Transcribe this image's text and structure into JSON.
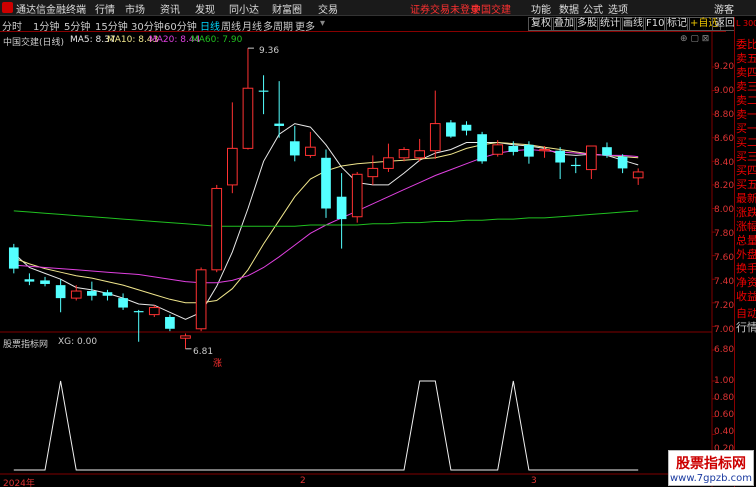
{
  "menubar": {
    "app_title": "通达信金融终端",
    "menus": [
      "行情",
      "市场",
      "资讯",
      "发现",
      "同小达",
      "财富圈",
      "交易"
    ],
    "notice": "证券交易未登录",
    "stock_name_right": "中国交建",
    "right_menus": [
      "功能",
      "数据",
      "公式",
      "选项"
    ],
    "guest": "游客"
  },
  "toolbar": {
    "periods": [
      "分时",
      "1分钟",
      "5分钟",
      "15分钟",
      "30分钟",
      "60分钟",
      "日线",
      "周线",
      "月线",
      "多周期",
      "更多"
    ],
    "active_period": "日线",
    "right_buttons": [
      "复权",
      "叠加",
      "多股",
      "统计",
      "画线",
      "F10",
      "标记",
      "+自选",
      "返回"
    ]
  },
  "right_panel": {
    "top_label": "L 300",
    "items": [
      "委比",
      "卖五",
      "卖四",
      "卖三",
      "卖二",
      "卖一",
      "买一",
      "买二",
      "买三",
      "买四",
      "买五",
      "最新",
      "涨跌",
      "涨幅",
      "总量",
      "外盘",
      "换手",
      "净资",
      "收益",
      "自动",
      "行情"
    ]
  },
  "main_chart": {
    "title": "中国交建(日线)",
    "ma_labels": [
      {
        "text": "MA5: 8.37",
        "color": "#e8e8e8"
      },
      {
        "text": "MA10: 8.43",
        "color": "#f0e68c"
      },
      {
        "text": "MA20: 8.44",
        "color": "#e040e0"
      },
      {
        "text": "MA60: 7.90",
        "color": "#20c020"
      }
    ],
    "high_label": "9.36",
    "low_label": "6.81",
    "zhang_label": "涨",
    "ylabels": [
      "9.20",
      "9.00",
      "8.80",
      "8.60",
      "8.40",
      "8.20",
      "8.00",
      "7.80",
      "7.60",
      "7.40",
      "7.20",
      "7.00",
      "6.80"
    ]
  },
  "sub_chart": {
    "title": "股票指标网",
    "xg_label": "XG: 0.00",
    "ylabels": [
      "1.00",
      "0.80",
      "0.60",
      "0.40",
      "0.20"
    ]
  },
  "x_axis": {
    "labels": [
      "2024年",
      "2",
      "3"
    ]
  },
  "watermark": {
    "line1": "股票指标网",
    "line2": "www.7gpzb.com"
  },
  "chart_data": {
    "type": "candlestick",
    "title": "中国交建(日线)",
    "ylim": [
      6.7,
      9.4
    ],
    "candles": [
      {
        "o": 7.67,
        "c": 7.49,
        "h": 7.7,
        "l": 7.45
      },
      {
        "o": 7.4,
        "c": 7.38,
        "h": 7.45,
        "l": 7.35
      },
      {
        "o": 7.39,
        "c": 7.36,
        "h": 7.42,
        "l": 7.34
      },
      {
        "o": 7.35,
        "c": 7.24,
        "h": 7.4,
        "l": 7.12
      },
      {
        "o": 7.24,
        "c": 7.3,
        "h": 7.35,
        "l": 7.22
      },
      {
        "o": 7.3,
        "c": 7.26,
        "h": 7.38,
        "l": 7.22
      },
      {
        "o": 7.29,
        "c": 7.26,
        "h": 7.31,
        "l": 7.22
      },
      {
        "o": 7.24,
        "c": 7.16,
        "h": 7.28,
        "l": 7.14
      },
      {
        "o": 7.13,
        "c": 7.12,
        "h": 7.14,
        "l": 6.87
      },
      {
        "o": 7.1,
        "c": 7.16,
        "h": 7.18,
        "l": 7.08
      },
      {
        "o": 7.08,
        "c": 6.98,
        "h": 7.1,
        "l": 6.96
      },
      {
        "o": 6.9,
        "c": 6.92,
        "h": 6.94,
        "l": 6.81
      },
      {
        "o": 6.98,
        "c": 7.48,
        "h": 7.5,
        "l": 6.96
      },
      {
        "o": 7.48,
        "c": 8.17,
        "h": 8.2,
        "l": 7.46
      },
      {
        "o": 8.2,
        "c": 8.51,
        "h": 8.9,
        "l": 8.13
      },
      {
        "o": 8.51,
        "c": 9.02,
        "h": 9.36,
        "l": 8.5
      },
      {
        "o": 9.0,
        "c": 8.99,
        "h": 9.13,
        "l": 8.8
      },
      {
        "o": 8.72,
        "c": 8.7,
        "h": 9.08,
        "l": 8.6
      },
      {
        "o": 8.57,
        "c": 8.45,
        "h": 8.7,
        "l": 8.4
      },
      {
        "o": 8.45,
        "c": 8.52,
        "h": 8.65,
        "l": 8.43
      },
      {
        "o": 8.43,
        "c": 8.0,
        "h": 8.5,
        "l": 7.92
      },
      {
        "o": 8.1,
        "c": 7.91,
        "h": 8.3,
        "l": 7.66
      },
      {
        "o": 7.93,
        "c": 8.29,
        "h": 8.31,
        "l": 7.88
      },
      {
        "o": 8.27,
        "c": 8.34,
        "h": 8.45,
        "l": 8.2
      },
      {
        "o": 8.34,
        "c": 8.43,
        "h": 8.55,
        "l": 8.31
      },
      {
        "o": 8.43,
        "c": 8.5,
        "h": 8.52,
        "l": 8.4
      },
      {
        "o": 8.43,
        "c": 8.49,
        "h": 8.59,
        "l": 8.4
      },
      {
        "o": 8.49,
        "c": 8.72,
        "h": 9.0,
        "l": 8.42
      },
      {
        "o": 8.73,
        "c": 8.61,
        "h": 8.75,
        "l": 8.6
      },
      {
        "o": 8.71,
        "c": 8.66,
        "h": 8.74,
        "l": 8.62
      },
      {
        "o": 8.63,
        "c": 8.4,
        "h": 8.65,
        "l": 8.38
      },
      {
        "o": 8.46,
        "c": 8.54,
        "h": 8.58,
        "l": 8.44
      },
      {
        "o": 8.53,
        "c": 8.48,
        "h": 8.57,
        "l": 8.45
      },
      {
        "o": 8.54,
        "c": 8.44,
        "h": 8.57,
        "l": 8.38
      },
      {
        "o": 8.49,
        "c": 8.5,
        "h": 8.53,
        "l": 8.43
      },
      {
        "o": 8.49,
        "c": 8.39,
        "h": 8.52,
        "l": 8.25
      },
      {
        "o": 8.37,
        "c": 8.36,
        "h": 8.43,
        "l": 8.3
      },
      {
        "o": 8.33,
        "c": 8.53,
        "h": 8.53,
        "l": 8.25
      },
      {
        "o": 8.52,
        "c": 8.45,
        "h": 8.56,
        "l": 8.43
      },
      {
        "o": 8.44,
        "c": 8.34,
        "h": 8.46,
        "l": 8.3
      },
      {
        "o": 8.26,
        "c": 8.31,
        "h": 8.34,
        "l": 8.2
      }
    ],
    "series": [
      {
        "name": "MA5",
        "color": "#e8e8e8",
        "values": [
          7.62,
          7.5,
          7.45,
          7.4,
          7.33,
          7.31,
          7.28,
          7.24,
          7.19,
          7.18,
          7.12,
          7.06,
          7.12,
          7.34,
          7.63,
          8.0,
          8.4,
          8.63,
          8.72,
          8.69,
          8.54,
          8.35,
          8.22,
          8.2,
          8.2,
          8.3,
          8.41,
          8.47,
          8.5,
          8.56,
          8.56,
          8.56,
          8.54,
          8.53,
          8.51,
          8.46,
          8.45,
          8.46,
          8.45,
          8.41,
          8.37
        ]
      },
      {
        "name": "MA10",
        "color": "#f0e68c",
        "values": [
          7.58,
          7.53,
          7.49,
          7.46,
          7.43,
          7.41,
          7.38,
          7.35,
          7.31,
          7.27,
          7.23,
          7.2,
          7.2,
          7.22,
          7.32,
          7.48,
          7.7,
          7.9,
          8.1,
          8.25,
          8.32,
          8.36,
          8.38,
          8.39,
          8.4,
          8.41,
          8.42,
          8.43,
          8.46,
          8.51,
          8.54,
          8.56,
          8.55,
          8.54,
          8.52,
          8.5,
          8.48,
          8.46,
          8.45,
          8.44,
          8.43
        ]
      },
      {
        "name": "MA20",
        "color": "#e040e0",
        "values": [
          7.52,
          7.51,
          7.5,
          7.49,
          7.48,
          7.47,
          7.46,
          7.45,
          7.44,
          7.42,
          7.4,
          7.38,
          7.37,
          7.37,
          7.39,
          7.43,
          7.5,
          7.59,
          7.69,
          7.79,
          7.86,
          7.92,
          7.98,
          8.04,
          8.1,
          8.16,
          8.22,
          8.28,
          8.33,
          8.38,
          8.43,
          8.47,
          8.49,
          8.5,
          8.49,
          8.48,
          8.47,
          8.46,
          8.45,
          8.45,
          8.44
        ]
      },
      {
        "name": "MA60",
        "color": "#20c020",
        "values": [
          7.98,
          7.97,
          7.96,
          7.95,
          7.94,
          7.93,
          7.92,
          7.91,
          7.9,
          7.89,
          7.88,
          7.87,
          7.86,
          7.85,
          7.85,
          7.85,
          7.85,
          7.85,
          7.85,
          7.86,
          7.86,
          7.86,
          7.86,
          7.87,
          7.87,
          7.88,
          7.88,
          7.89,
          7.89,
          7.9,
          7.9,
          7.91,
          7.91,
          7.92,
          7.92,
          7.93,
          7.94,
          7.95,
          7.96,
          7.97,
          7.98
        ]
      }
    ],
    "xg": [
      0,
      0,
      0,
      1,
      0,
      0,
      0,
      0,
      0,
      0,
      0,
      0,
      0,
      0,
      0,
      0,
      0,
      0,
      0,
      0,
      0,
      0,
      0,
      0,
      0,
      0,
      1,
      1,
      0,
      0,
      0,
      0,
      1,
      0,
      0,
      0,
      0,
      0,
      0,
      0,
      0
    ]
  }
}
